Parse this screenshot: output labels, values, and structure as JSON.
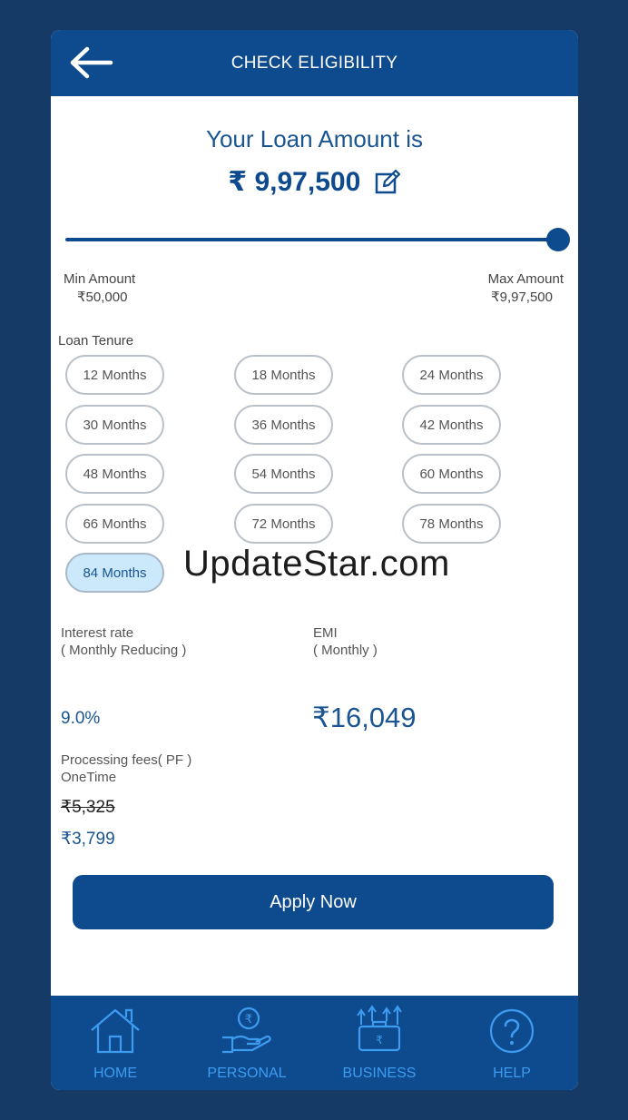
{
  "header": {
    "title": "CHECK ELIGIBILITY",
    "back_icon": "arrow-left-icon"
  },
  "loan": {
    "heading": "Your Loan Amount is",
    "amount": "₹ 9,97,500",
    "edit_icon": "edit-icon",
    "slider_value_fraction": 1.0,
    "min_label": "Min Amount",
    "min_value": "₹50,000",
    "max_label": "Max Amount",
    "max_value": "₹9,97,500"
  },
  "tenure": {
    "label": "Loan Tenure",
    "options": [
      "12 Months",
      "18 Months",
      "24 Months",
      "30 Months",
      "36 Months",
      "42 Months",
      "48 Months",
      "54 Months",
      "60 Months",
      "66 Months",
      "72 Months",
      "78 Months",
      "84 Months"
    ],
    "selected": "84 Months"
  },
  "watermark": "UpdateStar.com",
  "interest": {
    "label_line1": "Interest rate",
    "label_line2": "( Monthly Reducing )",
    "value": "9.0%"
  },
  "emi": {
    "label_line1": "EMI",
    "label_line2": "( Monthly )",
    "value": "₹16,049"
  },
  "processing_fee": {
    "label_line1": "Processing fees( PF )",
    "label_line2": "OneTime",
    "old_value": "₹5,325",
    "new_value": "₹3,799"
  },
  "apply_button": {
    "label": "Apply Now"
  },
  "nav": [
    {
      "label": "HOME",
      "icon": "home-icon"
    },
    {
      "label": "PERSONAL",
      "icon": "hand-rupee-icon"
    },
    {
      "label": "BUSINESS",
      "icon": "briefcase-growth-icon"
    },
    {
      "label": "HELP",
      "icon": "help-icon"
    }
  ],
  "colors": {
    "primary": "#0e4b8e",
    "background": "#163a66",
    "accent_text": "#1a5592",
    "nav_label": "#3e9cf0",
    "chip_selected": "#cce9fb"
  }
}
